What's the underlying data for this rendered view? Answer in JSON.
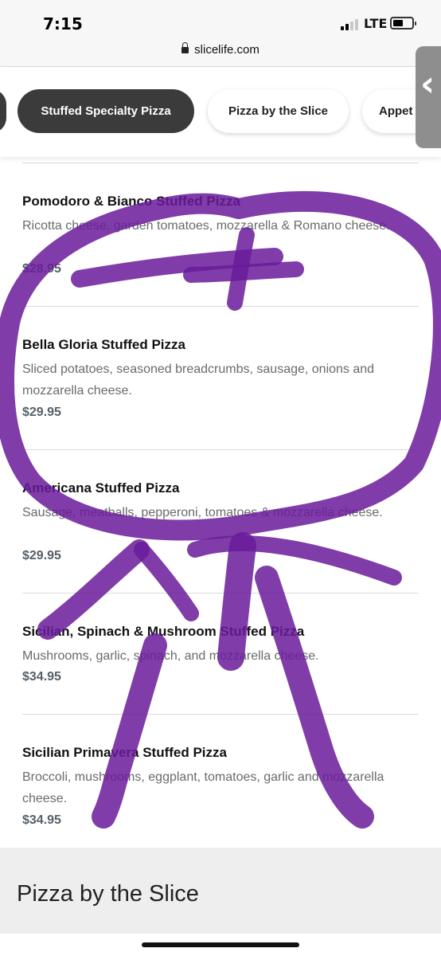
{
  "status_bar": {
    "time": "7:15",
    "network": "LTE"
  },
  "browser": {
    "url": "slicelife.com"
  },
  "category_tabs": [
    {
      "label": "Stuffed Specialty Pizza",
      "active": true
    },
    {
      "label": "Pizza by the Slice",
      "active": false
    },
    {
      "label": "Appet",
      "active": false
    }
  ],
  "side_handle": {
    "icon": "chevron-left-icon"
  },
  "menu_items": [
    {
      "name": "Pomodoro & Bianco Stuffed Pizza",
      "description": "Ricotta cheese, garden tomatoes, mozzarella & Romano cheese.",
      "price": "$28.95"
    },
    {
      "name": "Bella Gloria Stuffed Pizza",
      "description": "Sliced potatoes, seasoned breadcrumbs, sausage, onions and mozzarella cheese.",
      "price": "$29.95"
    },
    {
      "name": "Americana Stuffed Pizza",
      "description": "Sausage, meatballs, pepperoni, tomatoes & mozzarella cheese.",
      "price": "$29.95"
    },
    {
      "name": "Sicilian, Spinach & Mushroom Stuffed Pizza",
      "description": "Mushrooms, garlic, spinach, and mozzarella cheese.",
      "price": "$34.95"
    },
    {
      "name": "Sicilian Primavera Stuffed Pizza",
      "description": "Broccoli, mushrooms, eggplant, tomatoes, garlic and mozzarella cheese.",
      "price": "$34.95"
    }
  ],
  "next_section": {
    "title": "Pizza by the Slice"
  },
  "colors": {
    "active_tab": "#3b3b3b",
    "price": "#55606a",
    "scribble": "#6a1b9a"
  }
}
